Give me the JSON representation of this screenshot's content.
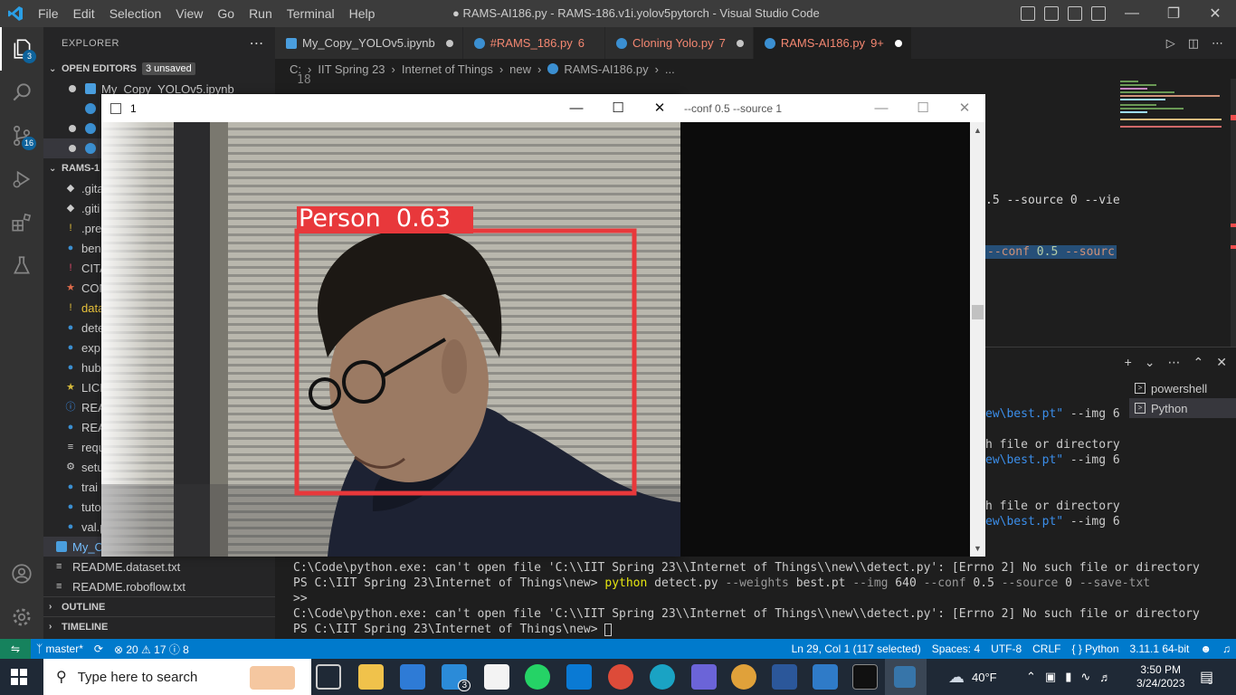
{
  "titlebar": {
    "menu": [
      "File",
      "Edit",
      "Selection",
      "View",
      "Go",
      "Run",
      "Terminal",
      "Help"
    ],
    "title": "● RAMS-AI186.py - RAMS-186.v1i.yolov5pytorch - Visual Studio Code"
  },
  "activity": {
    "explorer_badge": "3",
    "scm_badge": "16"
  },
  "sidebar": {
    "header": "EXPLORER",
    "open_editors_label": "OPEN EDITORS",
    "unsaved_pill": "3 unsaved",
    "open_editor_first": "My_Copy_YOLOv5.ipynb",
    "project_label": "RAMS-1",
    "files": [
      ".gita",
      ".giti",
      ".pre",
      "ben",
      "CITA",
      "CON",
      "data",
      "dete",
      "exp",
      "hub",
      "LICE",
      "REA",
      "REA",
      "requ",
      "setu",
      "trai",
      "tuto",
      "val.p"
    ],
    "my_copy": "My_Co",
    "readme_dataset": "README.dataset.txt",
    "readme_roboflow": "README.roboflow.txt",
    "outline": "OUTLINE",
    "timeline": "TIMELINE"
  },
  "tabs": [
    {
      "label": "My_Copy_YOLOv5.ipynb",
      "num": "",
      "color": "#cccccc"
    },
    {
      "label": "#RAMS_186.py",
      "num": "6",
      "color": "#f48771"
    },
    {
      "label": "Cloning Yolo.py",
      "num": "7",
      "color": "#f48771"
    },
    {
      "label": "RAMS-AI186.py",
      "num": "9+",
      "color": "#f48771"
    }
  ],
  "breadcrumb": {
    "parts": [
      "C:",
      "IIT Spring 23",
      "Internet of Things",
      "new",
      "RAMS-AI186.py",
      "..."
    ]
  },
  "editor": {
    "line_number": "18",
    "frag1": ".5 --source 0 --vie",
    "frag2_a": "--conf",
    "frag2_b": "0.5",
    "frag2_c": "--sourc"
  },
  "camera_window": {
    "title": "1",
    "detection_label": "Person  0.63"
  },
  "console_window": {
    "title": "--conf 0.5 --source 1"
  },
  "terminal": {
    "partial": [
      {
        "a": "ew\\best.pt\"",
        "b": " --img 6"
      },
      {
        "a": "",
        "b": "h file or directory"
      },
      {
        "a": "ew\\best.pt\"",
        "b": " --img 6"
      },
      {
        "a": "",
        "b": "h file or directory"
      },
      {
        "a": "ew\\best.pt\"",
        "b": " --img 6"
      }
    ],
    "line1": "C:\\Code\\python.exe: can't open file 'C:\\\\IIT Spring 23\\\\Internet of Things\\\\new\\\\detect.py': [Errno 2] No such file or directory",
    "line2_prompt": "PS C:\\IIT Spring 23\\Internet of Things\\new> ",
    "line2_cmd": "python",
    "line2_rest": " detect.py ",
    "line2_flag1": "--weights",
    "line2_v1": " best.pt ",
    "line2_flag2": "--img",
    "line2_v2": " 640 ",
    "line2_flag3": "--conf",
    "line2_v3": " 0.5 ",
    "line2_flag4": "--source",
    "line2_v4": " 0 ",
    "line2_flag5": "--save-txt",
    "line3": ">>",
    "line4": "C:\\Code\\python.exe: can't open file 'C:\\\\IIT Spring 23\\\\Internet of Things\\\\new\\\\detect.py': [Errno 2] No such file or directory",
    "line5_prompt": "PS C:\\IIT Spring 23\\Internet of Things\\new> ",
    "tabs": [
      "powershell",
      "Python"
    ]
  },
  "status": {
    "branch": "master*",
    "errors": "20",
    "warnings": "17",
    "info": "8",
    "position": "Ln 29, Col 1 (117 selected)",
    "spaces": "Spaces: 4",
    "encoding": "UTF-8",
    "eol": "CRLF",
    "language": "Python",
    "interpreter": "3.11.1 64-bit"
  },
  "taskbar": {
    "search_placeholder": "Type here to search",
    "mail_badge": "3",
    "weather": "40°F",
    "time": "3:50 PM",
    "date": "3/24/2023",
    "notif": "5"
  },
  "colors": {
    "accent": "#007acc",
    "detection_box": "#e8383b",
    "error_text": "#f48771"
  }
}
